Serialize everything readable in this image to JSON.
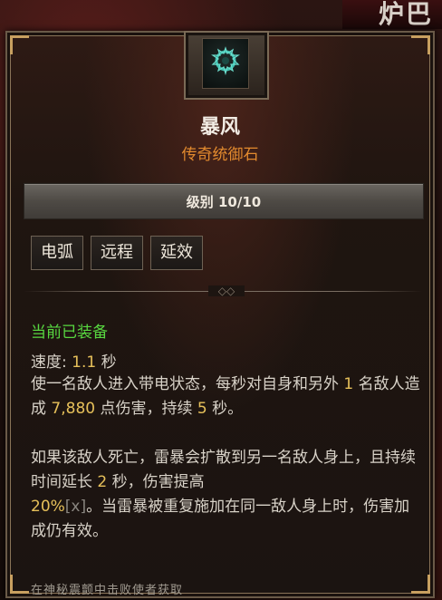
{
  "item": {
    "name": "暴风",
    "type": "传奇统御石",
    "level": "级别 10/10",
    "tags": [
      "电弧",
      "远程",
      "延效"
    ],
    "equipped": "当前已装备",
    "speed": {
      "label": "速度:",
      "value": "1.1",
      "unit": "秒"
    },
    "desc1": {
      "a": "使一名敌人进入带电状态，每秒对自身和另外",
      "n1": "1",
      "b": "名敌人造成",
      "n2": "7,880",
      "c": "点伤害，持续",
      "n3": "5",
      "d": "秒。"
    },
    "desc2": {
      "a": "如果该敌人死亡，雷暴会扩散到另一名敌人身上，且持续时间延长",
      "n1": "2",
      "b": "秒，伤害提高",
      "n2": "20%",
      "x": "[x]",
      "c": "。当雷暴被重复施加在同一敌人身上时，伤害加成仍有效。"
    },
    "source": "在神秘震颤中击败使者获取"
  },
  "background": {
    "corner_text": "炉巴"
  },
  "colors": {
    "title": "#f2ece4",
    "subtitle": "#e28a2e",
    "equipped": "#58d840",
    "highlight": "#e6c05a"
  },
  "icons": {
    "socket": "legendary-gem-icon",
    "divider": "ornament-divider-icon"
  }
}
